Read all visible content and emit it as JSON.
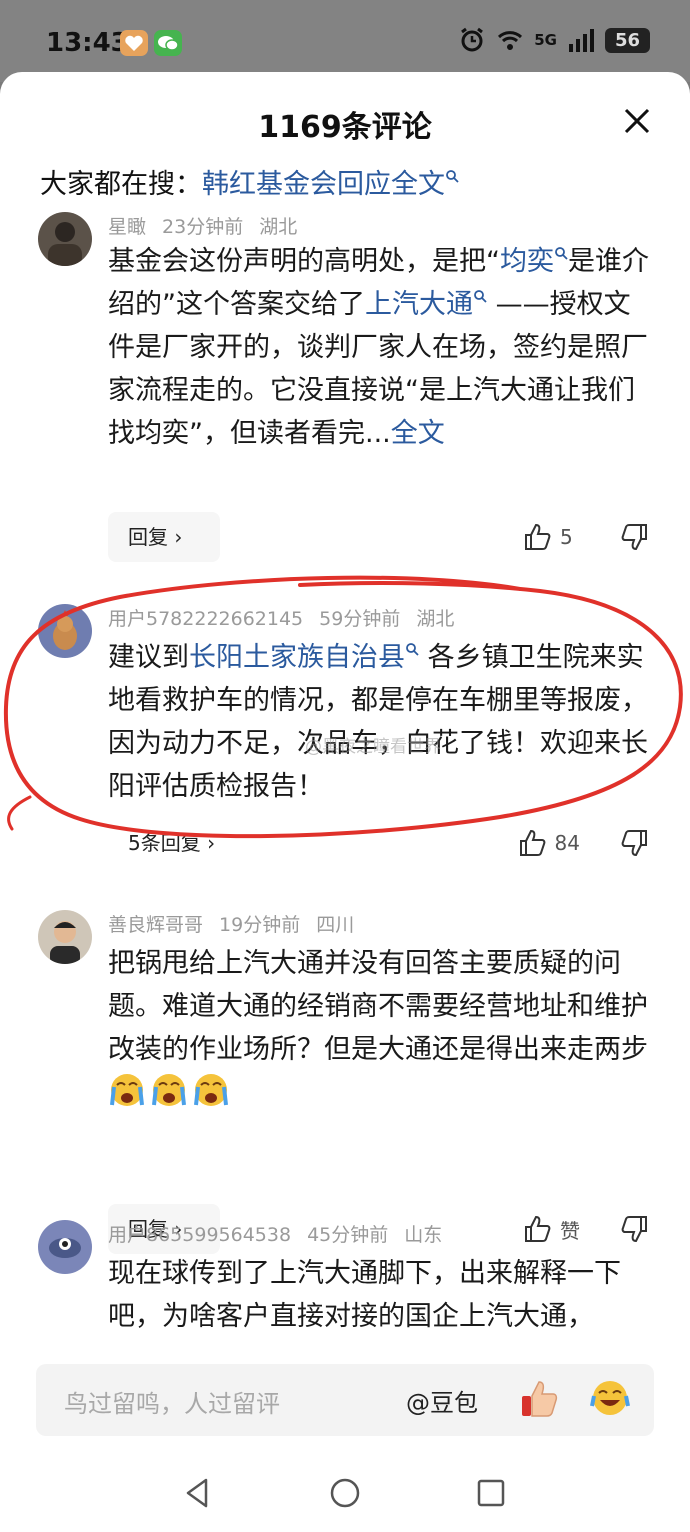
{
  "status_bar": {
    "time": "13:43",
    "signal_label": "5G",
    "battery": "56"
  },
  "header": {
    "title": "1169条评论"
  },
  "search": {
    "label": "大家都在搜：",
    "link": "韩红基金会回应全文"
  },
  "comments": [
    {
      "user": "星瞰",
      "time": "23分钟前",
      "location": "湖北",
      "text_a": "基金会这份声明的高明处，是把“",
      "link_a": "均奕",
      "text_b": "是谁介绍的”这个答案交给了",
      "link_b": "上汽大通",
      "text_c": " ——授权文件是厂家开的，谈判厂家人在场，签约是照厂家流程走的。它没直接说“是上汽大通让我们找均奕”，但读者看完...",
      "full_text_link": "全文",
      "reply_label": "回复",
      "likes": "5"
    },
    {
      "user": "用户5782222662145",
      "time": "59分钟前",
      "location": "湖北",
      "text_a": "建议到",
      "link_a": "长阳土家族自治县",
      "text_b": " 各乡镇卫生院来实地看救护车的情况，都是停在车棚里等报废，因为动力不足，次品车，白花了钱！欢迎来长阳评估质检报告！",
      "reply_label": "5条回复",
      "likes": "84"
    },
    {
      "user": "善良辉哥哥",
      "time": "19分钟前",
      "location": "四川",
      "text": "把锅甩给上汽大通并没有回答主要质疑的问题。难道大通的经销商不需要经营地址和维护改装的作业场所？但是大通还是得出来走两步",
      "reply_label": "回复",
      "likes": "赞"
    },
    {
      "user": "用户865599564538",
      "time": "45分钟前",
      "location": "山东",
      "text": "现在球传到了上汽大通脚下，出来解释一下吧，为啥客户直接对接的国企上汽大通，"
    }
  ],
  "watermark": "@黑夜之瞳看世界",
  "input": {
    "placeholder": "鸟过留鸣，人过留评",
    "mention": "@豆包"
  }
}
